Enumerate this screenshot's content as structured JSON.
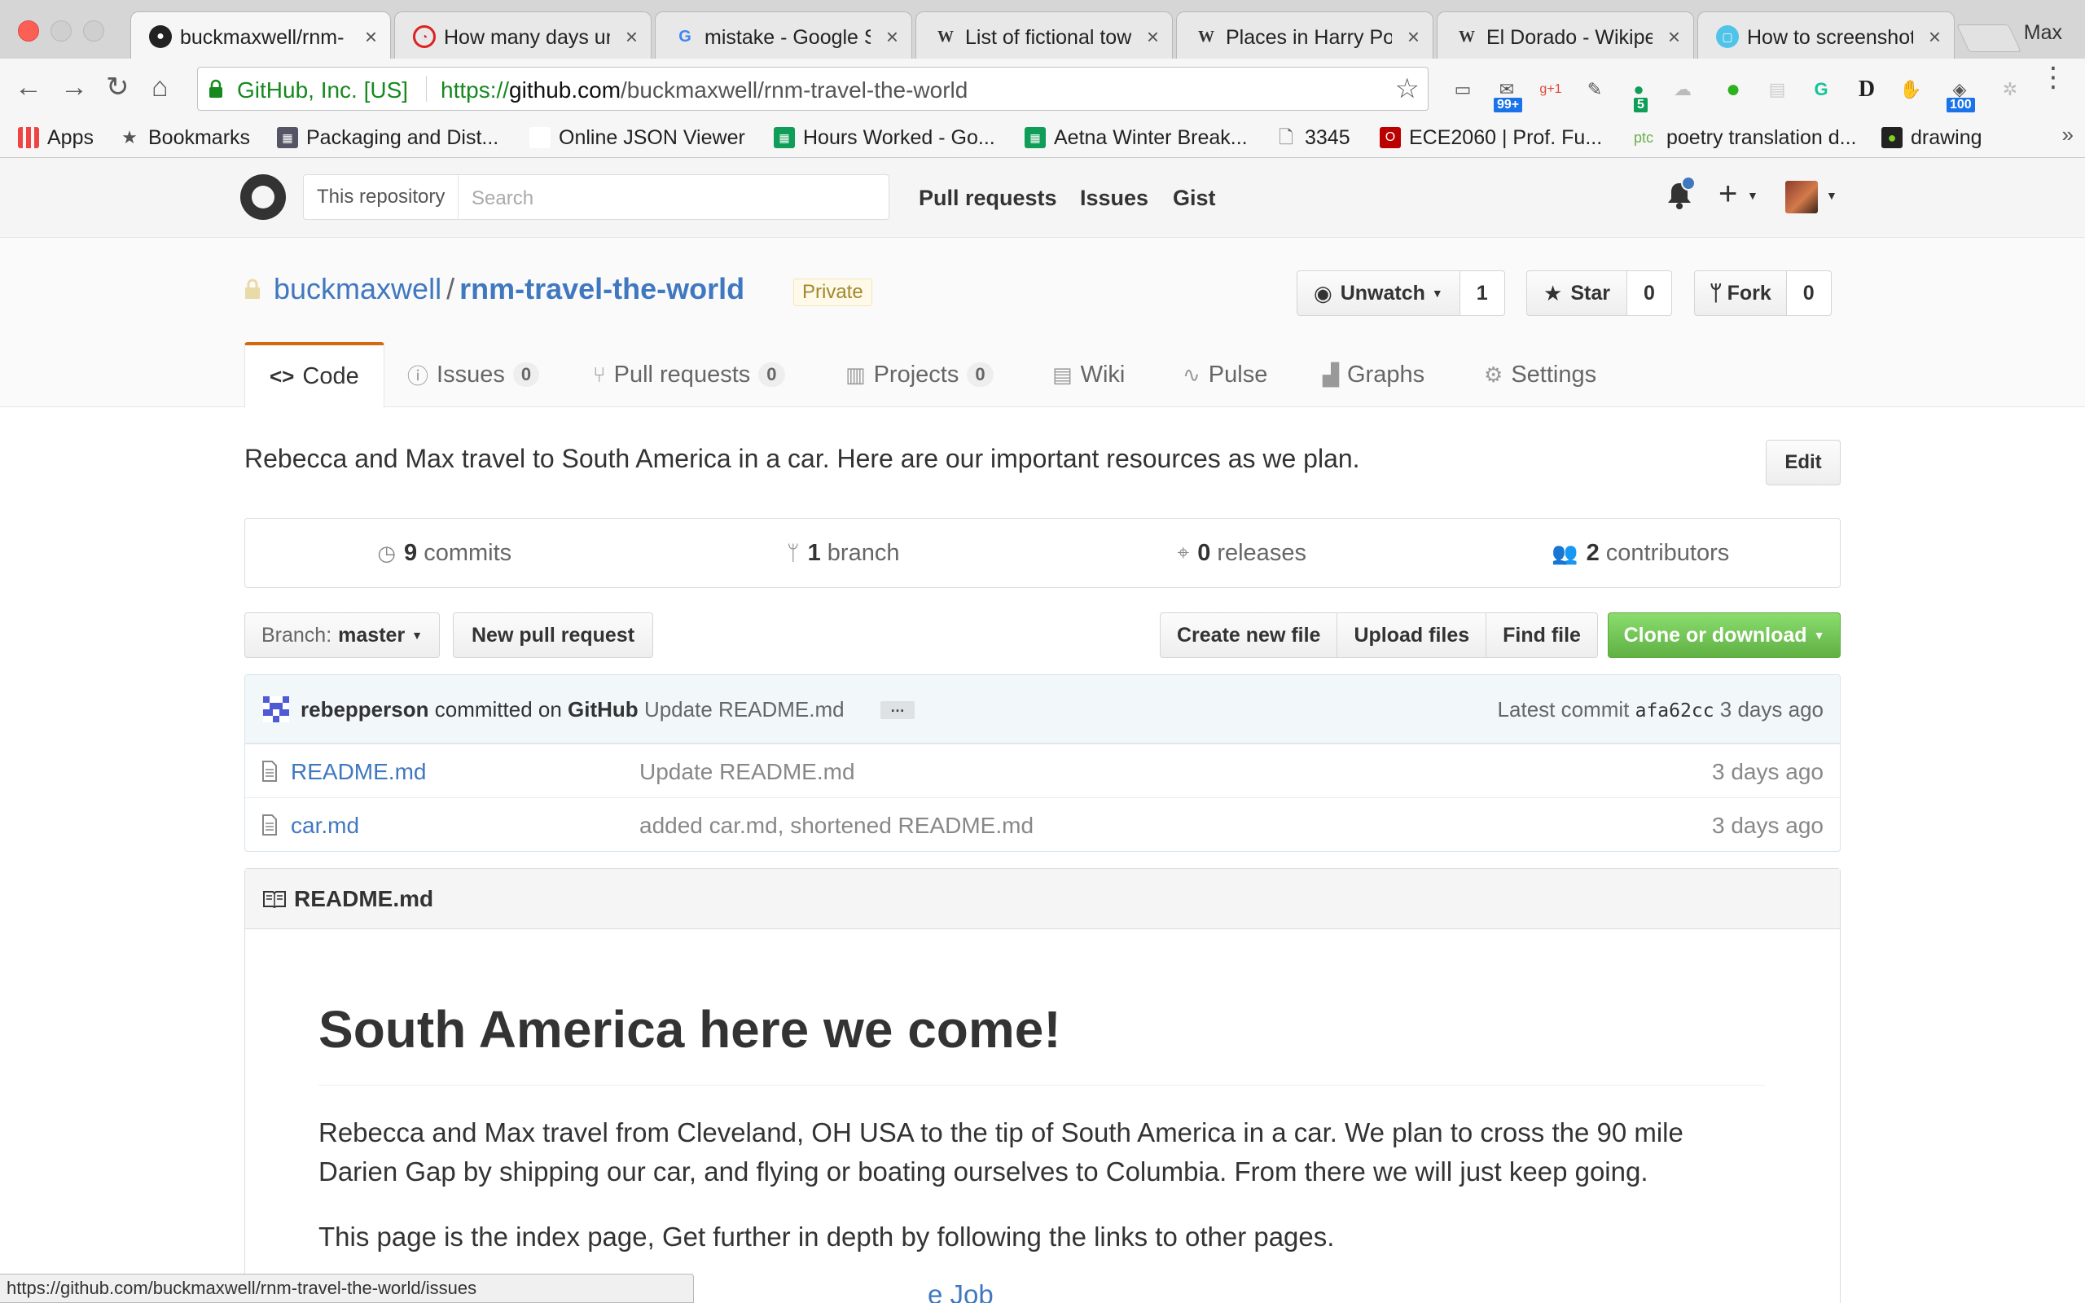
{
  "browser": {
    "tabs": [
      {
        "title": "buckmaxwell/rnm-",
        "icon": "github-icon",
        "active": true
      },
      {
        "title": "How many days un",
        "icon": "clock-icon"
      },
      {
        "title": "mistake - Google S",
        "icon": "google-icon"
      },
      {
        "title": "List of fictional tow",
        "icon": "wikipedia-icon"
      },
      {
        "title": "Places in Harry Pot",
        "icon": "wikipedia-icon"
      },
      {
        "title": "El Dorado - Wikipe",
        "icon": "wikipedia-icon"
      },
      {
        "title": "How to screenshot",
        "icon": "app-icon"
      }
    ],
    "profile_name": "Max",
    "ev_cert": "GitHub, Inc. [US]",
    "url_scheme": "https://",
    "url_host": "github.com",
    "url_path": "/buckmaxwell/rnm-travel-the-world",
    "extension_badges": {
      "mail": "99+",
      "gplus": "g+1",
      "hangouts": "5",
      "counter": "100"
    },
    "bookmarks": [
      "Apps",
      "Bookmarks",
      "Packaging and Dist...",
      "Online JSON Viewer",
      "Hours Worked - Go...",
      "Aetna Winter Break...",
      "3345",
      "ECE2060 | Prof. Fu...",
      "poetry translation d...",
      "drawing"
    ],
    "bookmarks_overflow": "»",
    "status_url": "https://github.com/buckmaxwell/rnm-travel-the-world/issues"
  },
  "github_header": {
    "search_scope": "This repository",
    "search_placeholder": "Search",
    "nav": [
      "Pull requests",
      "Issues",
      "Gist"
    ]
  },
  "repo": {
    "owner": "buckmaxwell",
    "separator": "/",
    "name": "rnm-travel-the-world",
    "visibility": "Private",
    "watch_label": "Unwatch",
    "watch_count": "1",
    "star_label": "Star",
    "star_count": "0",
    "fork_label": "Fork",
    "fork_count": "0",
    "tabs": [
      {
        "label": "Code",
        "count": ""
      },
      {
        "label": "Issues",
        "count": "0"
      },
      {
        "label": "Pull requests",
        "count": "0"
      },
      {
        "label": "Projects",
        "count": "0"
      },
      {
        "label": "Wiki",
        "count": ""
      },
      {
        "label": "Pulse",
        "count": ""
      },
      {
        "label": "Graphs",
        "count": ""
      },
      {
        "label": "Settings",
        "count": ""
      }
    ],
    "description": "Rebecca and Max travel to South America in a car. Here are our important resources as we plan.",
    "edit_label": "Edit",
    "summary": [
      {
        "num": "9",
        "label": "commits"
      },
      {
        "num": "1",
        "label": "branch"
      },
      {
        "num": "0",
        "label": "releases"
      },
      {
        "num": "2",
        "label": "contributors"
      }
    ],
    "branch_prefix": "Branch:",
    "branch_name": "master",
    "new_pr_label": "New pull request",
    "file_actions": [
      "Create new file",
      "Upload files",
      "Find file"
    ],
    "clone_label": "Clone or download",
    "latest_commit": {
      "author": "rebepperson",
      "committed_on": "committed on",
      "via": "GitHub",
      "message": "Update README.md",
      "ellipsis": "…",
      "latest_label": "Latest commit",
      "sha": "afa62cc",
      "age": "3 days ago"
    },
    "files": [
      {
        "name": "README.md",
        "message": "Update README.md",
        "age": "3 days ago"
      },
      {
        "name": "car.md",
        "message": "added car.md, shortened README.md",
        "age": "3 days ago"
      }
    ]
  },
  "readme": {
    "filename": "README.md",
    "heading": "South America here we come!",
    "paragraph1": "Rebecca and Max travel from Cleveland, OH USA to the tip of South America in a car. We plan to cross the 90 mile Darien Gap by shipping our car, and flying or boating ourselves to Columbia. From there we will just keep going.",
    "paragraph2": "This page is the index page, Get further in depth by following the links to other pages.",
    "link_partial": "e Job"
  },
  "colors": {
    "link": "#4078c0",
    "active_tab_border": "#d26911",
    "clone_green": "#60b044",
    "private_bg": "#fff9ea"
  }
}
